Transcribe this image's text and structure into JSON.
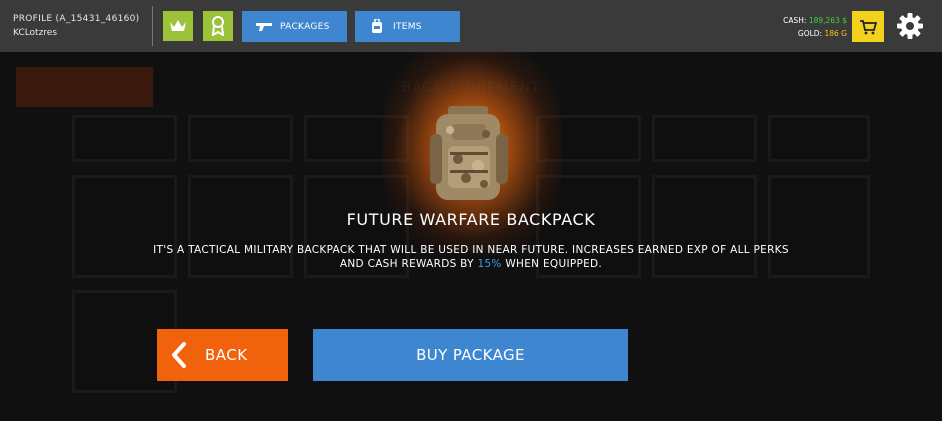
{
  "topbar": {
    "profile_id": "PROFILE (A_15431_46160)",
    "username": "KCLotzres",
    "packages_label": "PACKAGES",
    "items_label": "ITEMS",
    "cash_label": "CASH:",
    "cash_value": "189,263 $",
    "gold_label": "GOLD:",
    "gold_value": "186 G",
    "icons": [
      "crown-icon",
      "ribbon-icon",
      "gun-icon",
      "backpack-icon",
      "cart-icon",
      "gear-icon"
    ]
  },
  "background": {
    "title": "BACK EQUIPMENT"
  },
  "modal": {
    "item_name": "FUTURE WARFARE BACKPACK",
    "desc_before": "IT'S A TACTICAL MILITARY BACKPACK THAT WILL BE USED IN NEAR FUTURE. INCREASES EARNED EXP OF ALL PERKS AND CASH REWARDS BY",
    "desc_highlight": "15%",
    "desc_after": "WHEN EQUIPPED.",
    "back_label": "BACK",
    "buy_label": "BUY PACKAGE"
  },
  "colors": {
    "topbar": "#3a3a3a",
    "accent_blue": "#3f86d0",
    "accent_green": "#9cc23a",
    "back_orange": "#f1620d",
    "cart_yellow": "#f2d21c",
    "cash_green": "#3fd43f",
    "gold_yellow": "#f0c21f",
    "highlight_blue": "#3f9be6"
  }
}
